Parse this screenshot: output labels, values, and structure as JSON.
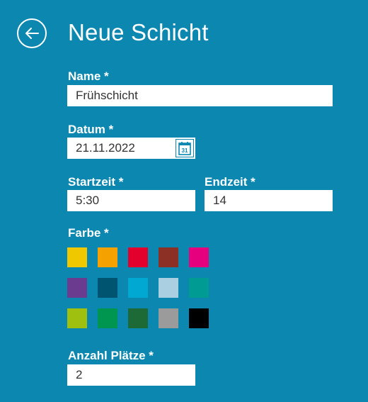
{
  "header": {
    "title": "Neue Schicht"
  },
  "form": {
    "name": {
      "label": "Name *",
      "value": "Frühschicht"
    },
    "date": {
      "label": "Datum *",
      "value": "21.11.2022",
      "calendar_day": "31"
    },
    "start": {
      "label": "Startzeit *",
      "value": "5:30"
    },
    "end": {
      "label": "Endzeit *",
      "value": "14"
    },
    "color": {
      "label": "Farbe *",
      "swatches": [
        "#f0c800",
        "#f5a200",
        "#e3002d",
        "#8c2f24",
        "#e6007e",
        "#6a3b8f",
        "#005470",
        "#00a8d2",
        "#a9cfe0",
        "#009b92",
        "#a0c010",
        "#009650",
        "#1e6a36",
        "#9b9b9b",
        "#000000"
      ]
    },
    "seats": {
      "label": "Anzahl Plätze *",
      "value": "2"
    }
  }
}
